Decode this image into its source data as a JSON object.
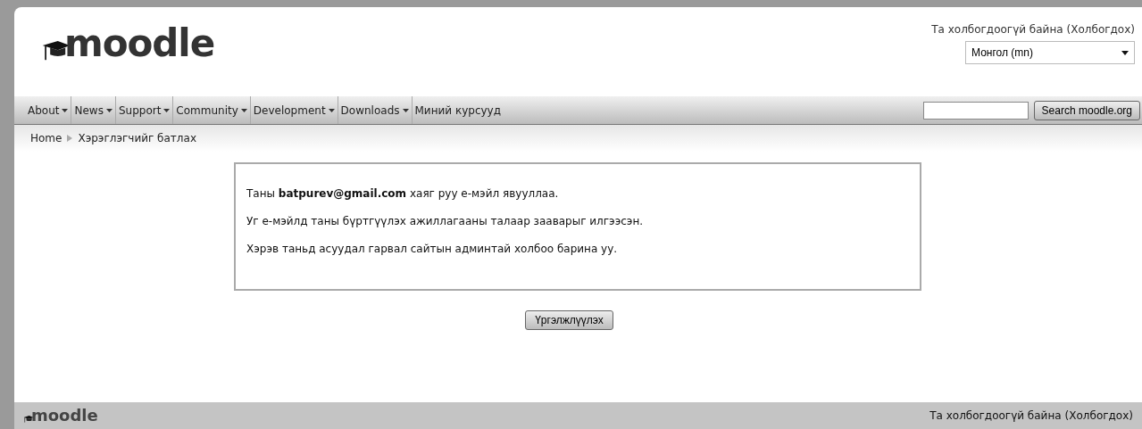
{
  "header": {
    "logo": "moodle",
    "login_status": "Та холбогдоогүй байна",
    "login_link": "(Холбогдох)",
    "language": "Монгол (mn)"
  },
  "nav": {
    "items": [
      {
        "label": "About",
        "dropdown": true
      },
      {
        "label": "News",
        "dropdown": true
      },
      {
        "label": "Support",
        "dropdown": true
      },
      {
        "label": "Community",
        "dropdown": true
      },
      {
        "label": "Development",
        "dropdown": true
      },
      {
        "label": "Downloads",
        "dropdown": true
      },
      {
        "label": "Миний курсууд",
        "dropdown": false
      }
    ],
    "search_button": "Search moodle.org"
  },
  "breadcrumb": [
    "Home",
    "Хэрэглэгчийг батлах"
  ],
  "message": [
    "Таны **batpurev@gmail.com** хаяг руу е-мэйл явууллаа.",
    "Уг е-мэйлд таны бүртгүүлэх ажиллагааны талаар зааварыг илгээсэн.",
    "Хэрэв таньд асуудал гарвал сайтын админтай холбоо барина уу."
  ],
  "continue_button": "Үргэлжлүүлэх",
  "footer": {
    "logo": "moodle",
    "login_status": "Та холбогдоогүй байна",
    "login_link": "(Холбогдох)"
  }
}
